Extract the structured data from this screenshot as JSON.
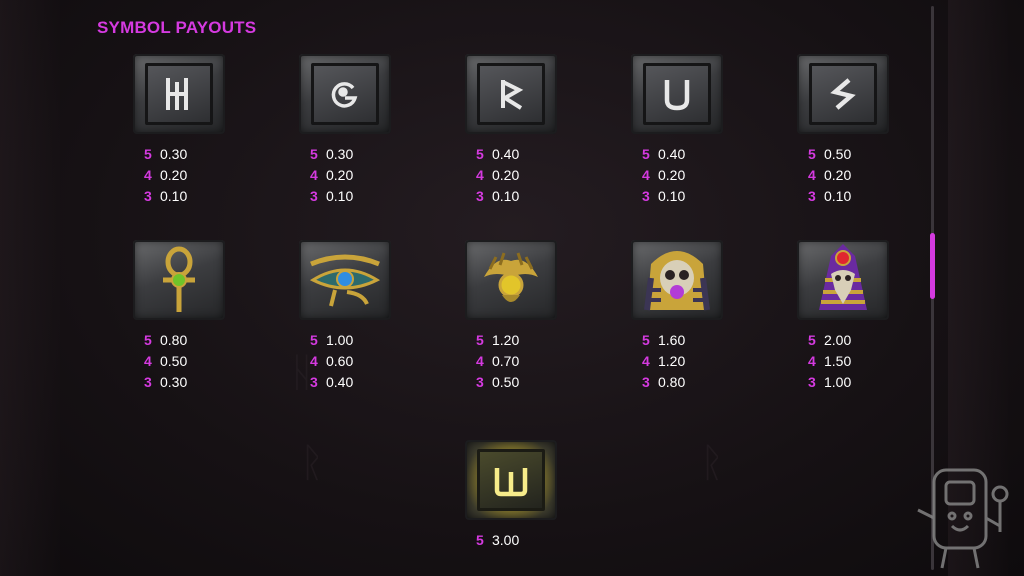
{
  "title": "SYMBOL PAYOUTS",
  "symbols": [
    {
      "icon": "rune-h-icon",
      "pays": [
        {
          "count": "5",
          "value": "0.30"
        },
        {
          "count": "4",
          "value": "0.20"
        },
        {
          "count": "3",
          "value": "0.10"
        }
      ]
    },
    {
      "icon": "rune-o-icon",
      "pays": [
        {
          "count": "5",
          "value": "0.30"
        },
        {
          "count": "4",
          "value": "0.20"
        },
        {
          "count": "3",
          "value": "0.10"
        }
      ]
    },
    {
      "icon": "rune-r-icon",
      "pays": [
        {
          "count": "5",
          "value": "0.40"
        },
        {
          "count": "4",
          "value": "0.20"
        },
        {
          "count": "3",
          "value": "0.10"
        }
      ]
    },
    {
      "icon": "rune-u-icon",
      "pays": [
        {
          "count": "5",
          "value": "0.40"
        },
        {
          "count": "4",
          "value": "0.20"
        },
        {
          "count": "3",
          "value": "0.10"
        }
      ]
    },
    {
      "icon": "rune-s-icon",
      "pays": [
        {
          "count": "5",
          "value": "0.50"
        },
        {
          "count": "4",
          "value": "0.20"
        },
        {
          "count": "3",
          "value": "0.10"
        }
      ]
    },
    {
      "icon": "ankh-icon",
      "pays": [
        {
          "count": "5",
          "value": "0.80"
        },
        {
          "count": "4",
          "value": "0.50"
        },
        {
          "count": "3",
          "value": "0.30"
        }
      ]
    },
    {
      "icon": "eye-of-horus-icon",
      "pays": [
        {
          "count": "5",
          "value": "1.00"
        },
        {
          "count": "4",
          "value": "0.60"
        },
        {
          "count": "3",
          "value": "0.40"
        }
      ]
    },
    {
      "icon": "scarab-icon",
      "pays": [
        {
          "count": "5",
          "value": "1.20"
        },
        {
          "count": "4",
          "value": "0.70"
        },
        {
          "count": "3",
          "value": "0.50"
        }
      ]
    },
    {
      "icon": "pharaoh-skull-icon",
      "pays": [
        {
          "count": "5",
          "value": "1.60"
        },
        {
          "count": "4",
          "value": "1.20"
        },
        {
          "count": "3",
          "value": "0.80"
        }
      ]
    },
    {
      "icon": "horus-bird-skull-icon",
      "pays": [
        {
          "count": "5",
          "value": "2.00"
        },
        {
          "count": "4",
          "value": "1.50"
        },
        {
          "count": "3",
          "value": "1.00"
        }
      ]
    },
    {
      "icon": "wild-w-icon",
      "pays": [
        {
          "count": "5",
          "value": "3.00"
        }
      ]
    }
  ],
  "colors": {
    "accent": "#d53ae0",
    "value_text": "#ffffff"
  }
}
